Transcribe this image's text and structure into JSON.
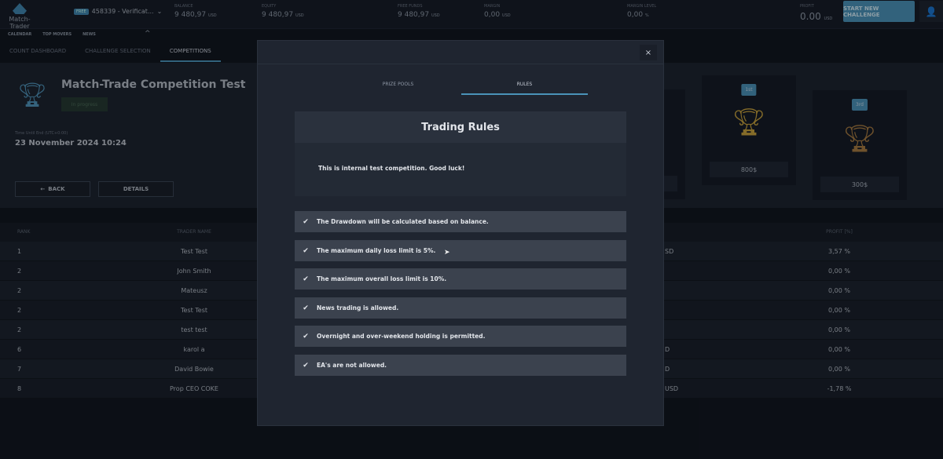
{
  "app": {
    "logo": "Match-Trader",
    "account": "458339 - Verificat...",
    "account_tag": "FREE"
  },
  "stats": [
    {
      "label": "BALANCE",
      "value": "9 480,97",
      "unit": "USD"
    },
    {
      "label": "EQUITY",
      "value": "9 480,97",
      "unit": "USD"
    },
    {
      "label": "FREE FUNDS",
      "value": "9 480,97",
      "unit": "USD"
    },
    {
      "label": "MARGIN",
      "value": "0,00",
      "unit": "USD"
    },
    {
      "label": "MARGIN LEVEL",
      "value": "0,00",
      "unit": "%"
    },
    {
      "label": "PROFIT",
      "value": "0.00",
      "unit": "USD"
    }
  ],
  "start_button": "START NEW CHALLENGE",
  "subnav": [
    "CALENDAR",
    "TOP MOVERS",
    "NEWS"
  ],
  "tabs": [
    "COUNT DASHBOARD",
    "CHALLENGE SELECTION",
    "COMPETITIONS"
  ],
  "competition": {
    "title": "Match-Trade Competition Test",
    "status": "In progress",
    "time_label": "Time Until End (UTC+0:00)",
    "time_value": "23 November 2024 10:24",
    "back": "BACK",
    "details": "DETAILS"
  },
  "prizes": [
    {
      "place": "1st",
      "amount": "800$",
      "color": "#c9a23a"
    },
    {
      "place": "3rd",
      "amount": "300$",
      "color": "#a87a3e"
    }
  ],
  "table": {
    "headers": {
      "rank": "RANK",
      "name": "TRADER NAME",
      "profit": "PROFIT [%]"
    },
    "rows": [
      {
        "rank": "1",
        "name": "Test Test",
        "curr": "SD",
        "profit": "3,57 %"
      },
      {
        "rank": "2",
        "name": "John Smith",
        "curr": "",
        "profit": "0,00 %"
      },
      {
        "rank": "2",
        "name": "Mateusz",
        "curr": "",
        "profit": "0,00 %"
      },
      {
        "rank": "2",
        "name": "Test Test",
        "curr": "",
        "profit": "0,00 %"
      },
      {
        "rank": "2",
        "name": "test test",
        "curr": "",
        "profit": "0,00 %"
      },
      {
        "rank": "6",
        "name": "karol a",
        "curr": "D",
        "profit": "0,00 %"
      },
      {
        "rank": "7",
        "name": "David Bowie",
        "curr": "D",
        "profit": "0,00 %"
      },
      {
        "rank": "8",
        "name": "Prop CEO COKE",
        "curr": "USD",
        "profit": "-1,78 %"
      }
    ]
  },
  "modal": {
    "close": "×",
    "tabs": [
      "PRIZE POOLS",
      "RULES"
    ],
    "active_tab": "RULES",
    "title": "Trading Rules",
    "intro": "This is internal test competition. Good luck!",
    "rules": [
      "The Drawdown will be calculated based on balance.",
      "The maximum daily loss limit is 5%.",
      "The maximum overall loss limit is 10%.",
      "News trading is allowed.",
      "Overnight and over-weekend holding is permitted.",
      "EA's are not allowed."
    ]
  }
}
